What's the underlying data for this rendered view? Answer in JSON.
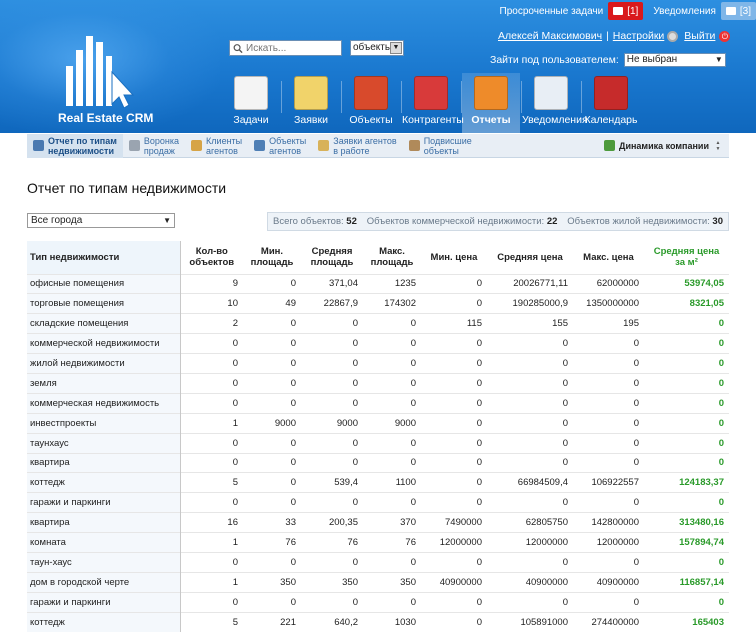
{
  "topbar": {
    "overdue_label": "Просроченные задачи",
    "overdue_count": "[1]",
    "notifications_label": "Уведомления",
    "notifications_count": "[3]"
  },
  "logo": {
    "text": "Real Estate CRM"
  },
  "search": {
    "placeholder": "Искать...",
    "scope": "объекты"
  },
  "user": {
    "name": "Алексей Максимович",
    "settings": "Настройки",
    "logout": "Выйти",
    "login_as_label": "Зайти под пользователем:",
    "login_as_value": "Не выбран"
  },
  "nav": [
    {
      "label": "Задачи",
      "icon": "tasks-icon",
      "color": "#f4f4f4"
    },
    {
      "label": "Заявки",
      "icon": "requests-icon",
      "color": "#f1d36a"
    },
    {
      "label": "Объекты",
      "icon": "house-icon",
      "color": "#d84a2c"
    },
    {
      "label": "Контрагенты",
      "icon": "contacts-icon",
      "color": "#d83a3a"
    },
    {
      "label": "Отчеты",
      "icon": "reports-icon",
      "color": "#ee8b2a"
    },
    {
      "label": "Уведомления",
      "icon": "notifications-icon",
      "color": "#e8eef5"
    },
    {
      "label": "Календарь",
      "icon": "calendar-icon",
      "color": "#c62b2b"
    }
  ],
  "subnav": [
    {
      "label1": "Отчет по типам",
      "label2": "недвижимости",
      "color": "#4a79b0"
    },
    {
      "label1": "Воронка",
      "label2": "продаж",
      "color": "#9aa4b0"
    },
    {
      "label1": "Клиенты",
      "label2": "агентов",
      "color": "#d6a447"
    },
    {
      "label1": "Объекты",
      "label2": "агентов",
      "color": "#4f7fb5"
    },
    {
      "label1": "Заявки агентов",
      "label2": "в работе",
      "color": "#d8b25a"
    },
    {
      "label1": "Подвисшие",
      "label2": "объекты",
      "color": "#b08a5a"
    },
    {
      "label1": "Динамика компании",
      "label2": "",
      "color": "#4d9a3c"
    }
  ],
  "page_title": "Отчет по типам недвижимости",
  "city_filter": "Все города",
  "stats": {
    "total_label": "Всего объектов:",
    "total": "52",
    "commercial_label": "Объектов коммерческой недвижимости:",
    "commercial": "22",
    "residential_label": "Объектов жилой недвижимости:",
    "residential": "30"
  },
  "table": {
    "headers": [
      "Тип недвижимости",
      "Кол-во объектов",
      "Мин. площадь",
      "Средняя площадь",
      "Макс. площадь",
      "Мин. цена",
      "Средняя цена",
      "Макс. цена",
      "Средняя цена за м²"
    ],
    "rows": [
      [
        "офисные помещения",
        "9",
        "0",
        "371,04",
        "1235",
        "0",
        "20026771,11",
        "62000000",
        "53974,05"
      ],
      [
        "торговые помещения",
        "10",
        "49",
        "22867,9",
        "174302",
        "0",
        "190285000,9",
        "1350000000",
        "8321,05"
      ],
      [
        "складские помещения",
        "2",
        "0",
        "0",
        "0",
        "115",
        "155",
        "195",
        "0"
      ],
      [
        "коммерческой недвижимости",
        "0",
        "0",
        "0",
        "0",
        "0",
        "0",
        "0",
        "0"
      ],
      [
        "жилой недвижимости",
        "0",
        "0",
        "0",
        "0",
        "0",
        "0",
        "0",
        "0"
      ],
      [
        "земля",
        "0",
        "0",
        "0",
        "0",
        "0",
        "0",
        "0",
        "0"
      ],
      [
        "коммерческая недвижимость",
        "0",
        "0",
        "0",
        "0",
        "0",
        "0",
        "0",
        "0"
      ],
      [
        "инвестпроекты",
        "1",
        "9000",
        "9000",
        "9000",
        "0",
        "0",
        "0",
        "0"
      ],
      [
        "таунхаус",
        "0",
        "0",
        "0",
        "0",
        "0",
        "0",
        "0",
        "0"
      ],
      [
        "квартира",
        "0",
        "0",
        "0",
        "0",
        "0",
        "0",
        "0",
        "0"
      ],
      [
        "коттедж",
        "5",
        "0",
        "539,4",
        "1100",
        "0",
        "66984509,4",
        "106922557",
        "124183,37"
      ],
      [
        "гаражи и паркинги",
        "0",
        "0",
        "0",
        "0",
        "0",
        "0",
        "0",
        "0"
      ],
      [
        "квартира",
        "16",
        "33",
        "200,35",
        "370",
        "7490000",
        "62805750",
        "142800000",
        "313480,16"
      ],
      [
        "комната",
        "1",
        "76",
        "76",
        "76",
        "12000000",
        "12000000",
        "12000000",
        "157894,74"
      ],
      [
        "таун-хаус",
        "0",
        "0",
        "0",
        "0",
        "0",
        "0",
        "0",
        "0"
      ],
      [
        "дом в городской черте",
        "1",
        "350",
        "350",
        "350",
        "40900000",
        "40900000",
        "40900000",
        "116857,14"
      ],
      [
        "гаражи и паркинги",
        "0",
        "0",
        "0",
        "0",
        "0",
        "0",
        "0",
        "0"
      ],
      [
        "коттедж",
        "5",
        "221",
        "640,2",
        "1030",
        "0",
        "105891000",
        "274400000",
        "165403"
      ]
    ]
  },
  "colors": {
    "header_blue": "#1a78cf",
    "accent_green": "#2a9a2a",
    "alert_red": "#d9191c"
  }
}
